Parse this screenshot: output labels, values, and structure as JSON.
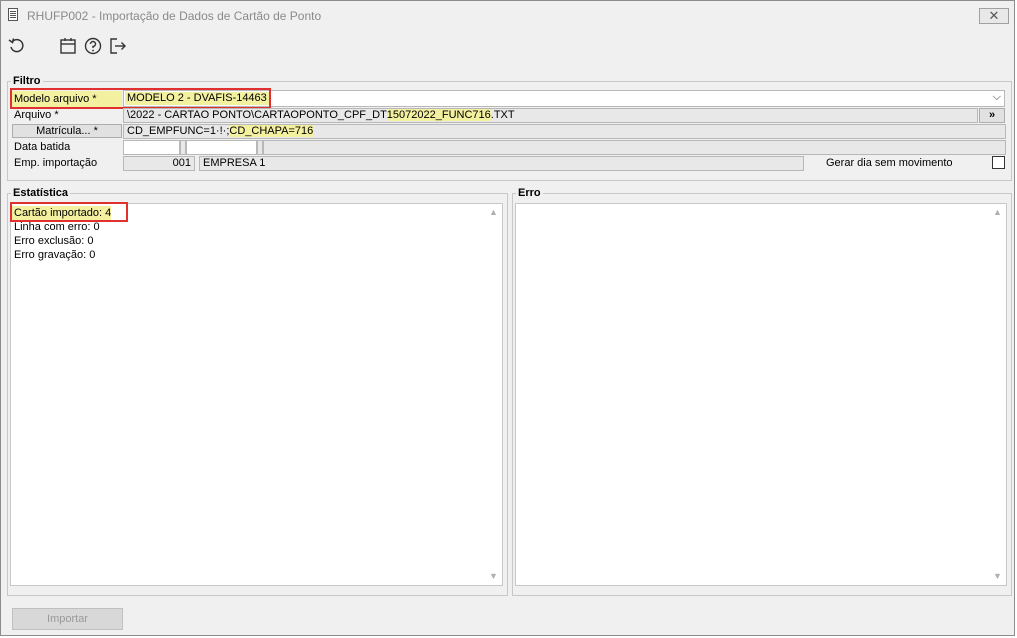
{
  "window": {
    "title": "RHUFP002 - Importação de Dados de Cartão de Ponto",
    "close_label": "✕"
  },
  "toolbar": {
    "icons": [
      "refresh-icon",
      "calendar-icon",
      "help-icon",
      "exit-icon"
    ]
  },
  "filtro": {
    "legend": "Filtro",
    "modelo_label": "Modelo arquivo *",
    "modelo_value": "MODELO 2 - DVAFIS-14463",
    "arquivo_label": "Arquivo *",
    "arquivo_value_a": "\\2022 - CARTAO PONTO\\CARTAOPONTO_CPF_DT",
    "arquivo_value_b": "15072022_FUNC716",
    "arquivo_value_c": ".TXT",
    "arquivo_button": "»",
    "matricula_button": "Matrícula... *",
    "matricula_value_a": "CD_EMPFUNC=1·!·;",
    "matricula_value_b": "CD_CHAPA=716",
    "data_label": "Data batida",
    "emp_label": "Emp. importação",
    "emp_code": "001",
    "emp_name": "EMPRESA 1",
    "gerar_label": "Gerar dia sem movimento",
    "gerar_checked": false
  },
  "estatistica": {
    "legend": "Estatística",
    "lines": [
      "Cartão importado: 4",
      "Linha com erro: 0",
      "Erro exclusão: 0",
      "Erro gravação: 0"
    ]
  },
  "erro": {
    "legend": "Erro"
  },
  "importar_label": "Importar",
  "colors": {
    "highlight": "#f3f0a0",
    "annotation_red": "#e03030",
    "window_bg": "#f0f0f0"
  }
}
